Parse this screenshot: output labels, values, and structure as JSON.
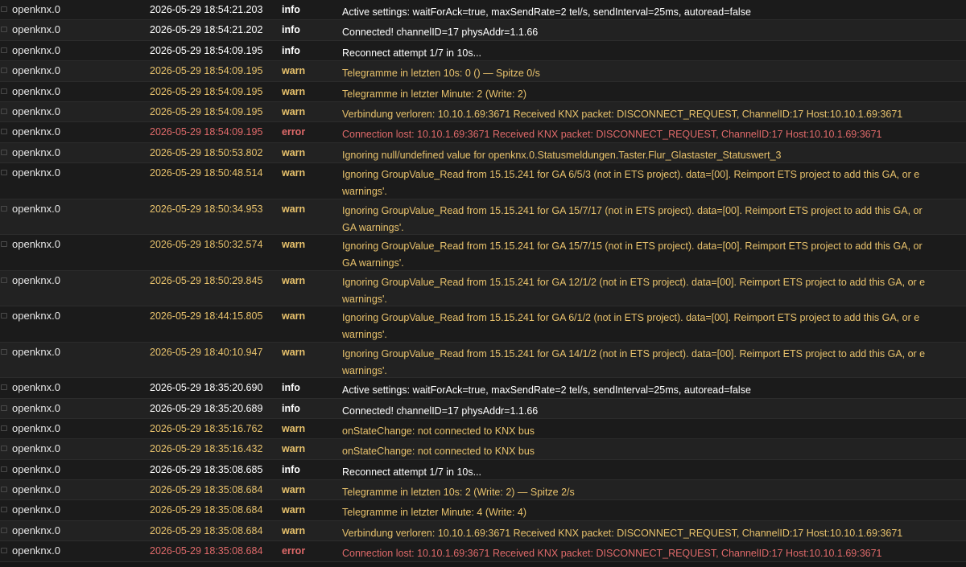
{
  "log": {
    "rows": [
      {
        "source": "openknx.0",
        "time": "2026-05-29 18:54:21.203",
        "level": "info",
        "message": "Active settings: waitForAck=true, maxSendRate=2 tel/s, sendInterval=25ms, autoread=false"
      },
      {
        "source": "openknx.0",
        "time": "2026-05-29 18:54:21.202",
        "level": "info",
        "message": "Connected! channelID=17 physAddr=1.1.66"
      },
      {
        "source": "openknx.0",
        "time": "2026-05-29 18:54:09.195",
        "level": "info",
        "message": "Reconnect attempt 1/7 in 10s..."
      },
      {
        "source": "openknx.0",
        "time": "2026-05-29 18:54:09.195",
        "level": "warn",
        "message": "Telegramme in letzten 10s: 0 () — Spitze 0/s"
      },
      {
        "source": "openknx.0",
        "time": "2026-05-29 18:54:09.195",
        "level": "warn",
        "message": "Telegramme in letzter Minute: 2 (Write: 2)"
      },
      {
        "source": "openknx.0",
        "time": "2026-05-29 18:54:09.195",
        "level": "warn",
        "message": "Verbindung verloren: 10.10.1.69:3671 Received KNX packet: DISCONNECT_REQUEST, ChannelID:17 Host:10.10.1.69:3671"
      },
      {
        "source": "openknx.0",
        "time": "2026-05-29 18:54:09.195",
        "level": "error",
        "message": "Connection lost: 10.10.1.69:3671 Received KNX packet: DISCONNECT_REQUEST, ChannelID:17 Host:10.10.1.69:3671"
      },
      {
        "source": "openknx.0",
        "time": "2026-05-29 18:50:53.802",
        "level": "warn",
        "message": "Ignoring null/undefined value for openknx.0.Statusmeldungen.Taster.Flur_Glastaster_Statuswert_3"
      },
      {
        "source": "openknx.0",
        "time": "2026-05-29 18:50:48.514",
        "level": "warn",
        "message": "Ignoring GroupValue_Read from 15.15.241 for GA 6/5/3 (not in ETS project). data=[00]. Reimport ETS project to add this GA, or e",
        "message2": "warnings'."
      },
      {
        "source": "openknx.0",
        "time": "2026-05-29 18:50:34.953",
        "level": "warn",
        "message": "Ignoring GroupValue_Read from 15.15.241 for GA 15/7/17 (not in ETS project). data=[00]. Reimport ETS project to add this GA, or",
        "message2": "GA warnings'."
      },
      {
        "source": "openknx.0",
        "time": "2026-05-29 18:50:32.574",
        "level": "warn",
        "message": "Ignoring GroupValue_Read from 15.15.241 for GA 15/7/15 (not in ETS project). data=[00]. Reimport ETS project to add this GA, or",
        "message2": "GA warnings'."
      },
      {
        "source": "openknx.0",
        "time": "2026-05-29 18:50:29.845",
        "level": "warn",
        "message": "Ignoring GroupValue_Read from 15.15.241 for GA 12/1/2 (not in ETS project). data=[00]. Reimport ETS project to add this GA, or e",
        "message2": "warnings'."
      },
      {
        "source": "openknx.0",
        "time": "2026-05-29 18:44:15.805",
        "level": "warn",
        "message": "Ignoring GroupValue_Read from 15.15.241 for GA 6/1/2 (not in ETS project). data=[00]. Reimport ETS project to add this GA, or e",
        "message2": "warnings'."
      },
      {
        "source": "openknx.0",
        "time": "2026-05-29 18:40:10.947",
        "level": "warn",
        "message": "Ignoring GroupValue_Read from 15.15.241 for GA 14/1/2 (not in ETS project). data=[00]. Reimport ETS project to add this GA, or e",
        "message2": "warnings'."
      },
      {
        "source": "openknx.0",
        "time": "2026-05-29 18:35:20.690",
        "level": "info",
        "message": "Active settings: waitForAck=true, maxSendRate=2 tel/s, sendInterval=25ms, autoread=false"
      },
      {
        "source": "openknx.0",
        "time": "2026-05-29 18:35:20.689",
        "level": "info",
        "message": "Connected! channelID=17 physAddr=1.1.66"
      },
      {
        "source": "openknx.0",
        "time": "2026-05-29 18:35:16.762",
        "level": "warn",
        "message": "onStateChange: not connected to KNX bus"
      },
      {
        "source": "openknx.0",
        "time": "2026-05-29 18:35:16.432",
        "level": "warn",
        "message": "onStateChange: not connected to KNX bus"
      },
      {
        "source": "openknx.0",
        "time": "2026-05-29 18:35:08.685",
        "level": "info",
        "message": "Reconnect attempt 1/7 in 10s..."
      },
      {
        "source": "openknx.0",
        "time": "2026-05-29 18:35:08.684",
        "level": "warn",
        "message": "Telegramme in letzten 10s: 2 (Write: 2) — Spitze 2/s"
      },
      {
        "source": "openknx.0",
        "time": "2026-05-29 18:35:08.684",
        "level": "warn",
        "message": "Telegramme in letzter Minute: 4 (Write: 4)"
      },
      {
        "source": "openknx.0",
        "time": "2026-05-29 18:35:08.684",
        "level": "warn",
        "message": "Verbindung verloren: 10.10.1.69:3671 Received KNX packet: DISCONNECT_REQUEST, ChannelID:17 Host:10.10.1.69:3671"
      },
      {
        "source": "openknx.0",
        "time": "2026-05-29 18:35:08.684",
        "level": "error",
        "message": "Connection lost: 10.10.1.69:3671 Received KNX packet: DISCONNECT_REQUEST, ChannelID:17 Host:10.10.1.69:3671"
      }
    ]
  }
}
